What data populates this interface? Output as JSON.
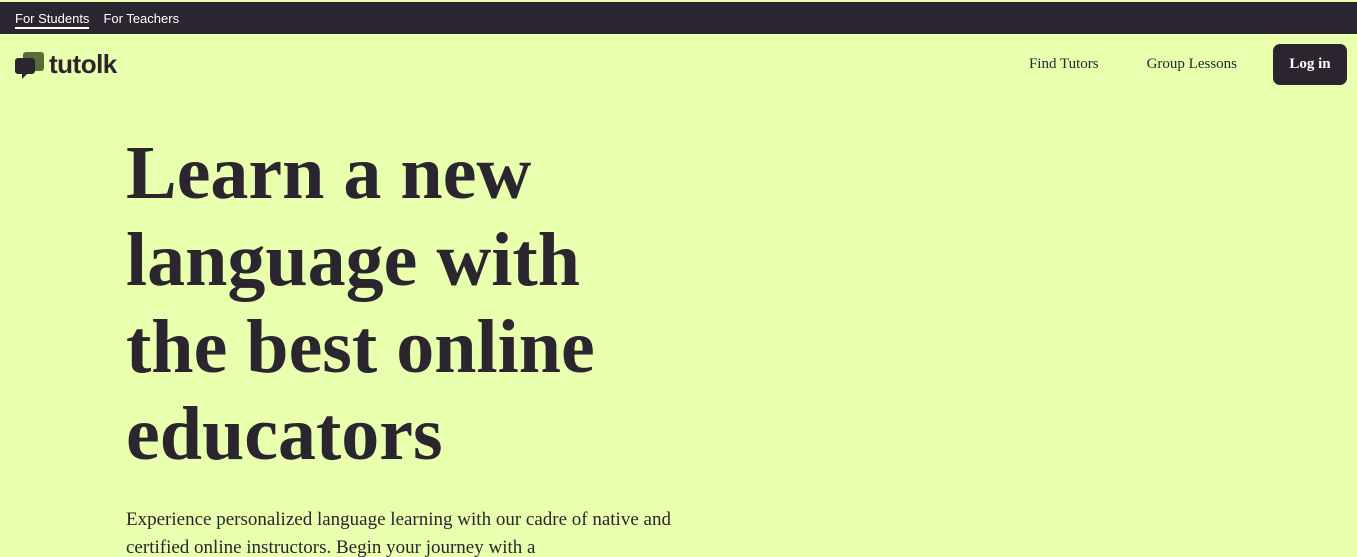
{
  "topbar": {
    "tabs": [
      {
        "label": "For Students",
        "active": true
      },
      {
        "label": "For Teachers",
        "active": false
      }
    ]
  },
  "nav": {
    "logo_text": "tutolk",
    "logo_icon": "speech-bubbles-icon",
    "links": [
      "Find Tutors",
      "Group Lessons"
    ],
    "login_label": "Log in"
  },
  "hero": {
    "heading_lines": [
      "Learn a new",
      "language with",
      "the best online",
      "educators"
    ],
    "subtitle": "Experience personalized language learning with our cadre of native and certified online instructors. Begin your journey with a"
  },
  "colors": {
    "background": "#e8ffad",
    "dark": "#2b2530",
    "white": "#ffffff"
  }
}
